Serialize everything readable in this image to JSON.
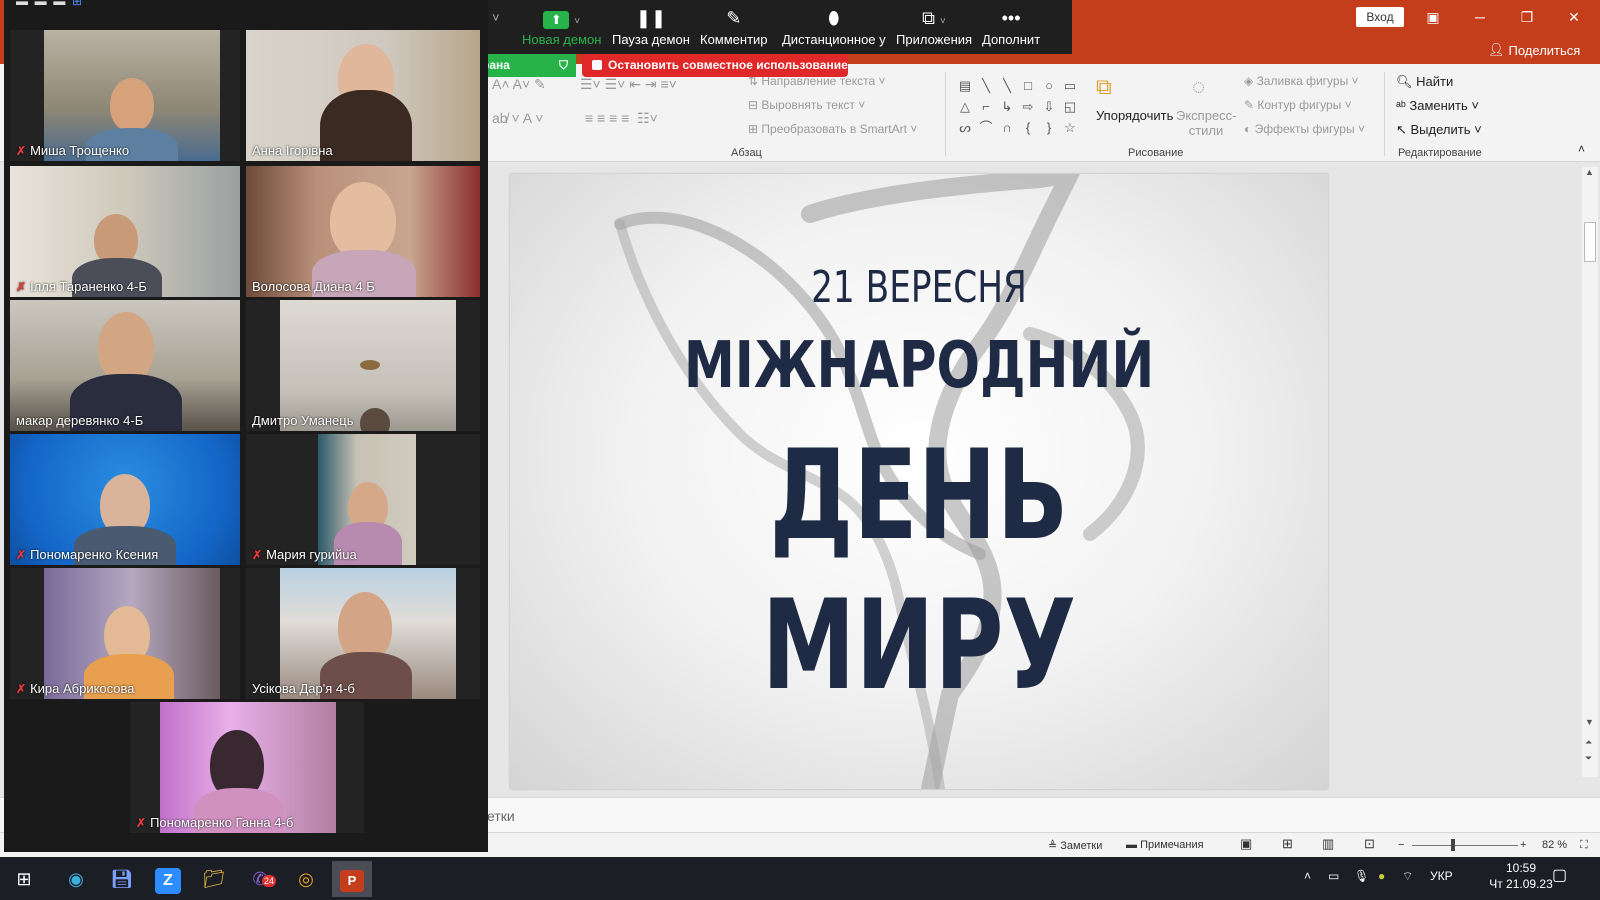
{
  "colors": {
    "ppt_accent": "#c43e1c",
    "zoom_green": "#27b34a",
    "zoom_red": "#e02828",
    "slide_text": "#1f2a45",
    "active_speaker": "#e6d94a"
  },
  "ppt": {
    "login_label": "Вход",
    "share_label": "Поделиться",
    "ribbon": {
      "text_direction": "Направление текста",
      "align_text": "Выровнять текст",
      "smartart": "Преобразовать в SmartArt",
      "arrange": "Упорядочить",
      "quick_styles": "Экспресс-стили",
      "shape_fill": "Заливка фигуры",
      "shape_outline": "Контур фигуры",
      "shape_effects": "Эффекты фигуры",
      "find": "Найти",
      "replace": "Заменить",
      "select": "Выделить",
      "group_paragraph": "Абзац",
      "group_drawing": "Рисование",
      "group_editing": "Редактирование"
    },
    "slide": {
      "line1": "21 ВЕРЕСНЯ",
      "line2": "МІЖНАРОДНИЙ",
      "line3": "ДЕНЬ",
      "line4": "МИРУ"
    },
    "notes_placeholder": "етки",
    "status": {
      "notes": "Заметки",
      "comments": "Примечания",
      "zoom_level": "82 %"
    }
  },
  "zoom": {
    "toolbar": {
      "new_share": "Новая демон",
      "pause_share": "Пауза демон",
      "annotate": "Комментир",
      "remote_control": "Дистанционное у",
      "apps": "Приложения",
      "more": "Дополнит"
    },
    "share_tab": "рана",
    "stop_share": "Остановить совместное использование",
    "participants": [
      {
        "name": "Миша Трощенко",
        "muted": true
      },
      {
        "name": "Анна Ігорівна",
        "muted": false
      },
      {
        "name": "Ілля Тараненко 4-Б",
        "muted": true
      },
      {
        "name": "Волосова Диана 4 Б",
        "muted": false
      },
      {
        "name": "макар  деревянко 4-Б",
        "muted": false
      },
      {
        "name": "Дмитро Уманець",
        "muted": false
      },
      {
        "name": "Пономаренко Ксения",
        "muted": true
      },
      {
        "name": "Мария гурийuа",
        "muted": true
      },
      {
        "name": "Кира Абрикосова",
        "muted": true
      },
      {
        "name": "Усікова Дар'я 4-б",
        "muted": false
      },
      {
        "name": "Пономаренко Ганна 4-б",
        "muted": true
      }
    ],
    "muted_icon": "muted-mic-icon"
  },
  "taskbar": {
    "language": "УКР",
    "time": "10:59",
    "date": "Чт 21.09.23",
    "badge_count": "24"
  }
}
